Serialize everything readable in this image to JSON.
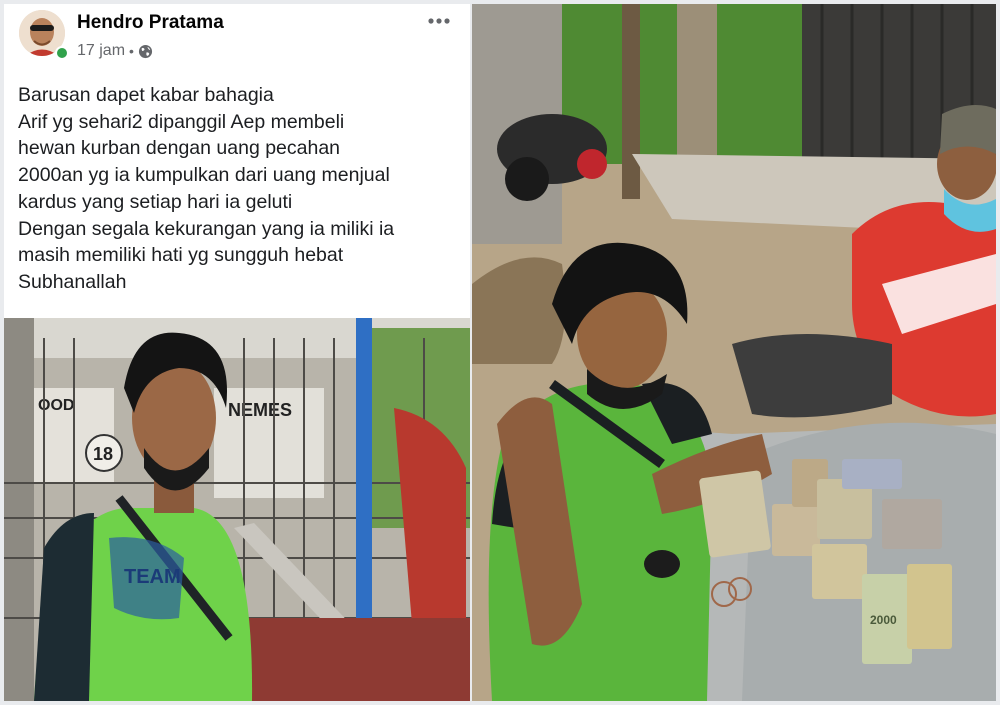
{
  "post": {
    "author_name": "Hendro Pratama",
    "timestamp": "17 jam",
    "separator": "•",
    "privacy_icon": "globe-icon",
    "more_icon": "more-options-icon",
    "online_status_color": "#31a24c",
    "body_lines": [
      "Barusan dapet kabar bahagia",
      "Arif yg sehari2 dipanggil Aep membeli",
      "hewan kurban dengan uang pecahan",
      "2000an yg ia kumpulkan dari uang menjual",
      "kardus yang setiap hari ia geluti",
      "Dengan segala kekurangan yang ia miliki ia",
      "masih memiliki hati yg sungguh hebat",
      "Subhanallah"
    ]
  },
  "photos": {
    "left": {
      "sign_text_left": "OOD",
      "sign_number": "18",
      "sign_text_right": "NEMES",
      "shirt_text": "TEAM"
    },
    "right": {
      "banknote_label": "2000"
    }
  }
}
